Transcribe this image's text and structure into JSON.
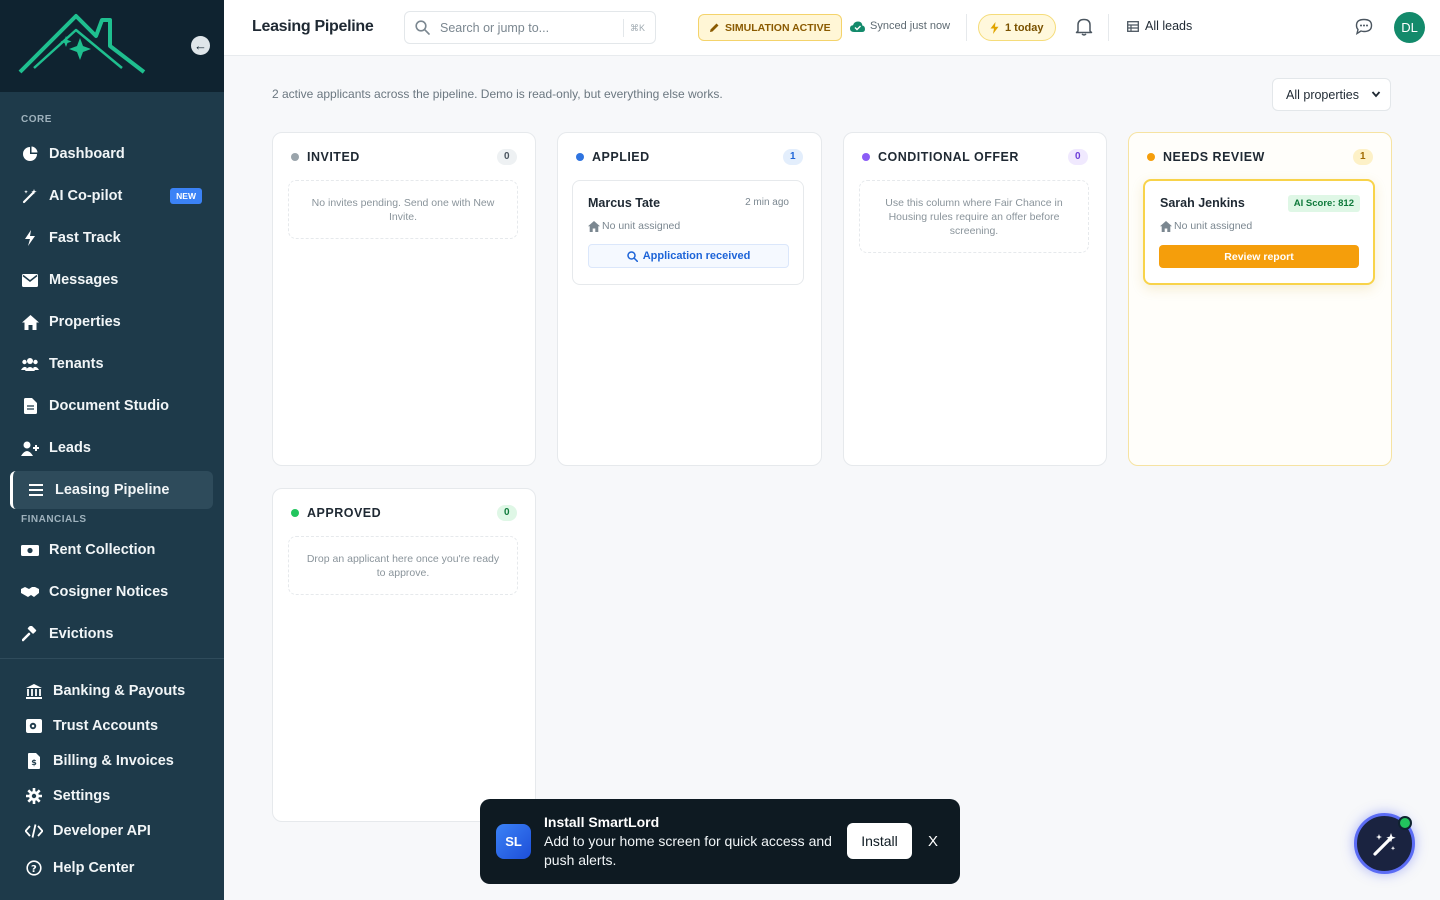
{
  "sidebar": {
    "sections": {
      "core": "CORE",
      "financials": "FINANCIALS"
    },
    "items": [
      {
        "label": "Dashboard",
        "icon": "pie-chart-icon"
      },
      {
        "label": "AI Co-pilot",
        "icon": "magic-wand-icon",
        "badge": "NEW"
      },
      {
        "label": "Fast Track",
        "icon": "lightning-icon"
      },
      {
        "label": "Messages",
        "icon": "envelope-icon"
      },
      {
        "label": "Properties",
        "icon": "home-icon"
      },
      {
        "label": "Tenants",
        "icon": "users-icon"
      },
      {
        "label": "Document Studio",
        "icon": "document-icon"
      },
      {
        "label": "Leads",
        "icon": "user-plus-icon"
      },
      {
        "label": "Leasing Pipeline",
        "icon": "list-icon",
        "active": true
      },
      {
        "label": "Rent Collection",
        "icon": "money-icon"
      },
      {
        "label": "Cosigner Notices",
        "icon": "handshake-icon"
      },
      {
        "label": "Evictions",
        "icon": "gavel-icon"
      },
      {
        "label": "Banking & Payouts",
        "icon": "bank-icon"
      },
      {
        "label": "Trust Accounts",
        "icon": "vault-icon"
      },
      {
        "label": "Billing & Invoices",
        "icon": "invoice-icon"
      },
      {
        "label": "Settings",
        "icon": "gear-icon"
      },
      {
        "label": "Developer API",
        "icon": "code-icon"
      },
      {
        "label": "Help Center",
        "icon": "help-icon"
      }
    ]
  },
  "header": {
    "title": "Leasing Pipeline",
    "search_placeholder": "Search or jump to...",
    "search_shortcut": "⌘K",
    "simulation": "SIMULATION ACTIVE",
    "synced": "Synced just now",
    "today": "1 today",
    "all_leads": "All leads",
    "avatar_initials": "DL"
  },
  "main": {
    "subtitle": "2 active applicants across the pipeline. Demo is read-only, but everything else works.",
    "property_filter": "All properties"
  },
  "columns": {
    "invited": {
      "title": "INVITED",
      "count": "0",
      "empty": "No invites pending. Send one with New Invite."
    },
    "applied": {
      "title": "APPLIED",
      "count": "1"
    },
    "conditional": {
      "title": "CONDITIONAL OFFER",
      "count": "0",
      "empty": "Use this column where Fair Chance in Housing rules require an offer before screening."
    },
    "review": {
      "title": "NEEDS REVIEW",
      "count": "1"
    },
    "approved": {
      "title": "APPROVED",
      "count": "0",
      "empty": "Drop an applicant here once you're ready to approve."
    }
  },
  "cards": {
    "marcus": {
      "name": "Marcus Tate",
      "time": "2 min ago",
      "unit": "No unit assigned",
      "action": "Application received"
    },
    "sarah": {
      "name": "Sarah Jenkins",
      "score": "AI Score: 812",
      "unit": "No unit assigned",
      "action": "Review report"
    }
  },
  "install": {
    "icon_text": "SL",
    "title": "Install SmartLord",
    "body": "Add to your home screen for quick access and push alerts.",
    "button": "Install",
    "close": "X"
  },
  "colors": {
    "sidebar": "#1e3a4a",
    "accent_orange": "#f59e0b",
    "accent_blue": "#1d64d8",
    "brand_green": "#138a6b"
  }
}
